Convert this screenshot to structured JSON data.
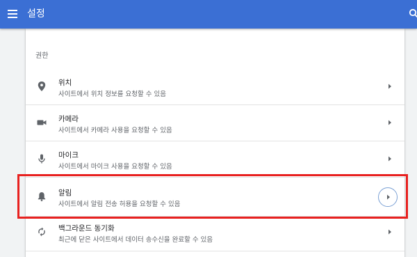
{
  "header": {
    "title": "설정",
    "background_color": "#3b6fd4",
    "menu_icon": "hamburger-icon",
    "search_icon": "search-icon"
  },
  "section": {
    "header": "권한"
  },
  "permissions": [
    {
      "name": "location",
      "icon": "location-pin-icon",
      "label": "위치",
      "description": "사이트에서 위치 정보를 요청할 수 있음"
    },
    {
      "name": "camera",
      "icon": "camera-icon",
      "label": "카메라",
      "description": "사이트에서 카메라 사용을 요청할 수 있음"
    },
    {
      "name": "microphone",
      "icon": "microphone-icon",
      "label": "마이크",
      "description": "사이트에서 마이크 사용을 요청할 수 있음"
    },
    {
      "name": "notifications",
      "icon": "bell-icon",
      "label": "알림",
      "description": "사이트에서 알림 전송 허용을 요청할 수 있음"
    },
    {
      "name": "background-sync",
      "icon": "sync-icon",
      "label": "백그라운드 동기화",
      "description": "최근에 닫은 사이트에서 데이터 송수신을 완료할 수 있음"
    }
  ],
  "highlight_color": "#e8211f"
}
